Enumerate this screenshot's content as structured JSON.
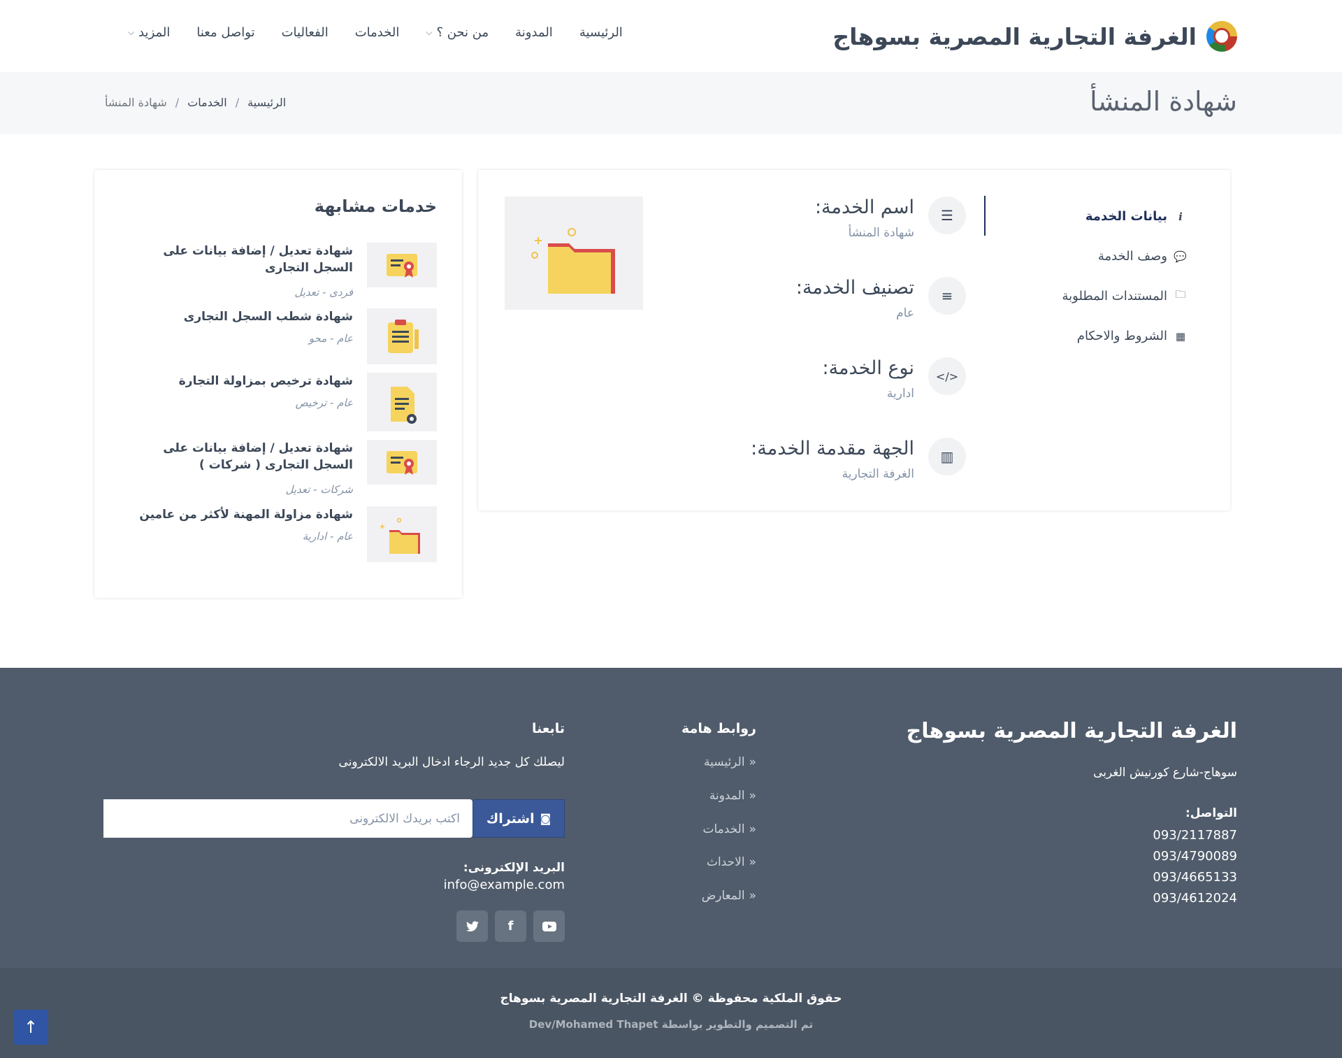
{
  "header": {
    "brand_title": "الغرفة التجارية المصرية بسوهاج",
    "nav": [
      {
        "label": "الرئيسية",
        "dropdown": false
      },
      {
        "label": "المدونة",
        "dropdown": false
      },
      {
        "label": "من نحن ؟",
        "dropdown": true
      },
      {
        "label": "الخدمات",
        "dropdown": false
      },
      {
        "label": "الفعاليات",
        "dropdown": false
      },
      {
        "label": "تواصل معنا",
        "dropdown": false
      },
      {
        "label": "المزيد",
        "dropdown": true
      }
    ]
  },
  "title_band": {
    "page_title": "شهادة المنشأ",
    "breadcrumb": [
      "الرئيسية",
      "الخدمات",
      "شهادة المنشأ"
    ],
    "separator": "/"
  },
  "main": {
    "tabs": [
      {
        "label": "بيانات الخدمة",
        "icon": "info-icon",
        "active": true
      },
      {
        "label": "وصف الخدمة",
        "icon": "comment-icon",
        "active": false
      },
      {
        "label": "المستندات المطلوبة",
        "icon": "folder-icon",
        "active": false
      },
      {
        "label": "الشروط والاحكام",
        "icon": "calculator-icon",
        "active": false
      }
    ],
    "info": [
      {
        "label": "اسم الخدمة:",
        "value": "شهادة المنشأ",
        "icon": "text-align-icon"
      },
      {
        "label": "تصنيف الخدمة:",
        "value": "عام",
        "icon": "menu-icon"
      },
      {
        "label": "نوع الخدمة:",
        "value": "ادارية",
        "icon": "code-icon"
      },
      {
        "label": "الجهة مقدمة الخدمة:",
        "value": "الغرفة التجارية",
        "icon": "building-icon"
      }
    ]
  },
  "similar": {
    "title": "خدمات مشابهة",
    "items": [
      {
        "name": "شهادة تعديل / إضافة بيانات على السجل التجارى",
        "meta": "فردى - تعديل",
        "icon": "certificate-icon"
      },
      {
        "name": "شهادة شطب السجل التجارى",
        "meta": "عام - محو",
        "icon": "clipboard-icon"
      },
      {
        "name": "شهادة ترخيص بمزاولة التجارة",
        "meta": "عام - ترخيص",
        "icon": "document-settings-icon"
      },
      {
        "name": "شهادة تعديل / إضافة بيانات على السجل التجارى ( شركات )",
        "meta": "شركات - تعديل",
        "icon": "certificate-icon"
      },
      {
        "name": "شهادة مزاولة المهنة لأكثر من عامين",
        "meta": "عام - ادارية",
        "icon": "folder-icon"
      }
    ]
  },
  "footer": {
    "title": "الغرفة التجارية المصرية بسوهاج",
    "address": "سوهاج-شارع كورنيش الغربى",
    "contact_label": "التواصل:",
    "phones": [
      "093/2117887",
      "093/4790089",
      "093/4665133",
      "093/4612024"
    ],
    "links_title": "روابط هامة",
    "links": [
      "الرئيسية",
      "المدونة",
      "الخدمات",
      "الاحداث",
      "المعارض"
    ],
    "follow_title": "تابعنا",
    "follow_text": "ليصلك كل جديد الرجاء ادخال البريد الالكترونى",
    "subscribe_placeholder": "اكتب بريدك الالكترونى",
    "subscribe_label": "اشتراك",
    "email_label": "البريد الإلكترونى:",
    "email": "info@example.com",
    "socials": [
      {
        "name": "twitter-icon",
        "glyph": "🐦"
      },
      {
        "name": "facebook-icon",
        "glyph": "f"
      },
      {
        "name": "youtube-icon",
        "glyph": "▶"
      }
    ]
  },
  "copyright": {
    "main": "حقوق الملكية محفوظة © الغرفة التجارية المصرية بسوهاج",
    "sub": "تم التصميم والتطوير بواسطة Dev/Mohamed Thapet"
  }
}
